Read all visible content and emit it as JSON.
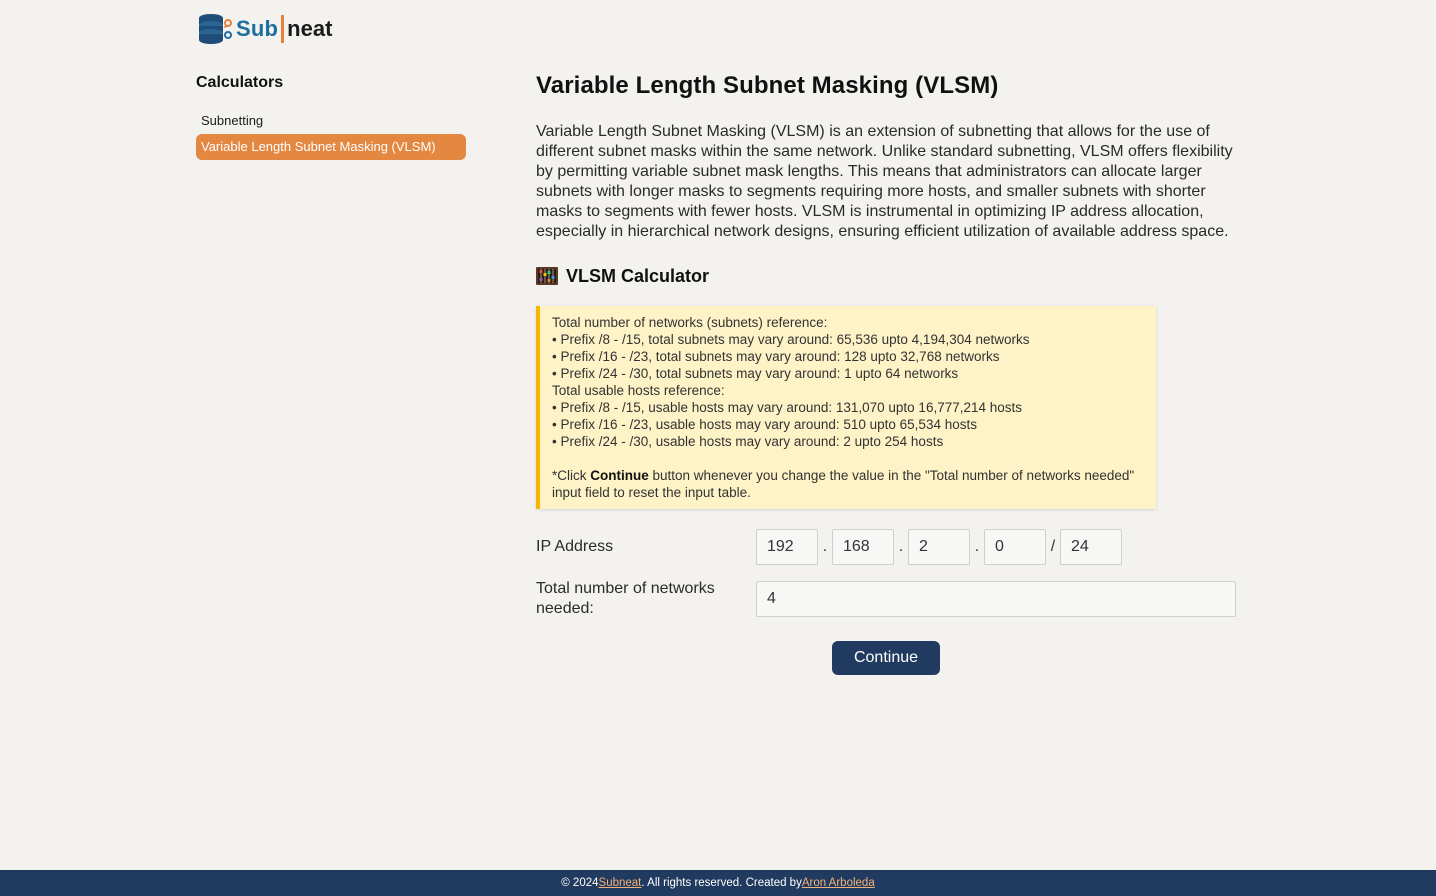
{
  "brand": {
    "part1": "Sub",
    "part2": "neat"
  },
  "sidebar": {
    "heading": "Calculators",
    "items": [
      {
        "label": "Subnetting",
        "active": false
      },
      {
        "label": "Variable Length Subnet Masking (VLSM)",
        "active": true
      }
    ]
  },
  "main": {
    "title": "Variable Length Subnet Masking (VLSM)",
    "intro": "Variable Length Subnet Masking (VLSM) is an extension of subnetting that allows for the use of different subnet masks within the same network. Unlike standard subnetting, VLSM offers flexibility by permitting variable subnet mask lengths. This means that administrators can allocate larger subnets with longer masks to segments requiring more hosts, and smaller subnets with shorter masks to segments with fewer hosts. VLSM is instrumental in optimizing IP address allocation, especially in hierarchical network designs, ensuring efficient utilization of available address space.",
    "calculator_title": "VLSM Calculator",
    "notice": {
      "networks_heading": "Total number of networks (subnets) reference:",
      "networks_lines": [
        "• Prefix /8 - /15, total subnets may vary around: 65,536 upto 4,194,304 networks",
        "• Prefix /16 - /23, total subnets may vary around: 128 upto 32,768 networks",
        "• Prefix /24 - /30, total subnets may vary around: 1 upto 64 networks"
      ],
      "hosts_heading": "Total usable hosts reference:",
      "hosts_lines": [
        "• Prefix /8 - /15, usable hosts may vary around: 131,070 upto 16,777,214 hosts",
        "• Prefix /16 - /23, usable hosts may vary around: 510 upto 65,534 hosts",
        "• Prefix /24 - /30, usable hosts may vary around: 2 upto 254 hosts"
      ],
      "footnote_pre": "*Click ",
      "footnote_bold": "Continue",
      "footnote_post": " button whenever you change the value in the \"Total number of networks needed\" input field to reset the input table."
    },
    "form": {
      "ip_label": "IP Address",
      "octets": [
        "192",
        "168",
        "2",
        "0"
      ],
      "prefix": "24",
      "dot": ".",
      "slash": "/",
      "networks_label": "Total number of networks needed:",
      "networks_value": "4",
      "continue_label": "Continue"
    }
  },
  "footer": {
    "prefix": "© 2024 ",
    "site_link": "Subneat",
    "middle": ". All rights reserved. Created by ",
    "author_link": "Aron Arboleda"
  },
  "colors": {
    "accent_orange": "#e48741",
    "navy": "#213a5f",
    "notice_bg": "#fef3c7",
    "notice_border": "#f5b700"
  }
}
